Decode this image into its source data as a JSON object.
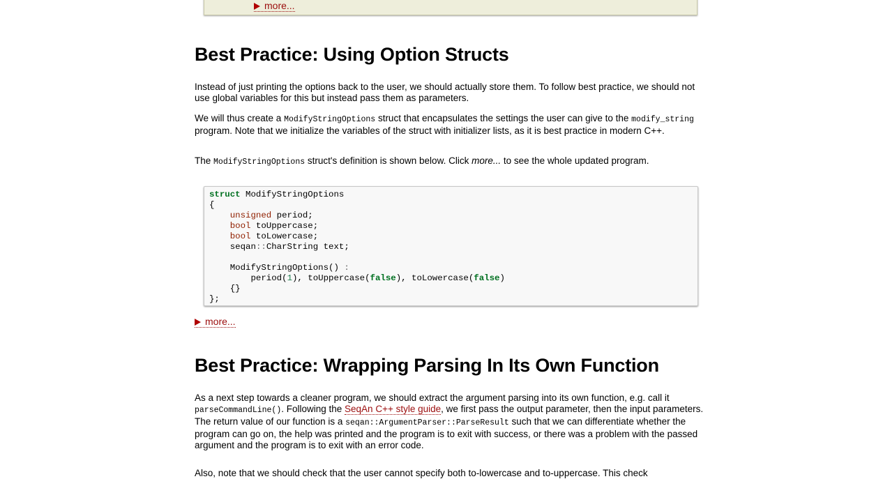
{
  "top_box": {
    "more_label": "more..."
  },
  "section1": {
    "heading": "Best Practice: Using Option Structs",
    "p1": "Instead of just printing the options back to the user, we should actually store them. To follow best practice, we should not use global variables for this but instead pass them as parameters.",
    "p2_a": "We will thus create a ",
    "p2_code1": "ModifyStringOptions",
    "p2_b": " struct that encapsulates the settings the user can give to the ",
    "p2_code2": "modify_string",
    "p2_c": " program. Note that we initialize the variables of the struct with initializer lists, as it is best practice in modern C++.",
    "p3_a": "The ",
    "p3_code": "ModifyStringOptions",
    "p3_b": " struct's definition is shown below. Click ",
    "p3_em": "more...",
    "p3_c": " to see the whole updated program.",
    "code": {
      "l1_kw": "struct",
      "l1_name": " ModifyStringOptions",
      "l2": "{",
      "l3_ty": "unsigned",
      "l3_rest": " period;",
      "l4_ty": "bool",
      "l4_rest": " toUppercase;",
      "l5_ty": "bool",
      "l5_rest": " toLowercase;",
      "l6_a": "seqan",
      "l6_op": "::",
      "l6_b": "CharString text;",
      "l8_a": "ModifyStringOptions() ",
      "l8_op": ":",
      "l9_a": "period(",
      "l9_num": "1",
      "l9_b": "), toUppercase(",
      "l9_bool1": "false",
      "l9_c": "), toLowercase(",
      "l9_bool2": "false",
      "l9_d": ")",
      "l10": "{}",
      "l11": "};"
    },
    "more_label": "more..."
  },
  "section2": {
    "heading": "Best Practice: Wrapping Parsing In Its Own Function",
    "p1_a": "As a next step towards a cleaner program, we should extract the argument parsing into its own function, e.g. call it ",
    "p1_code1": "parseCommandLine()",
    "p1_b": ". Following the ",
    "p1_link": "SeqAn C++ style guide",
    "p1_c": ", we first pass the output parameter, then the input parameters. The return value of our function is a ",
    "p1_code2": "seqan::ArgumentParser::ParseResult",
    "p1_d": " such that we can differentiate whether the program can go on, the help was printed and the program is to exit with success, or there was a problem with the passed argument and the program is to exit with an error code.",
    "p2": "Also, note that we should check that the user cannot specify both to-lowercase and to-uppercase. This check"
  }
}
